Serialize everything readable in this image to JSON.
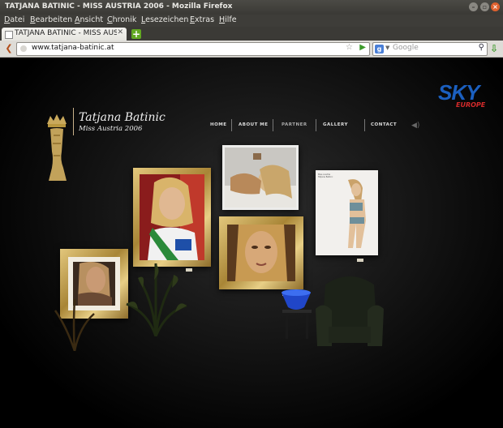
{
  "window": {
    "title": "TATJANA BATINIC - MISS AUSTRIA 2006 - Mozilla Firefox"
  },
  "menu": [
    "Datei",
    "Bearbeiten",
    "Ansicht",
    "Chronik",
    "Lesezeichen",
    "Extras",
    "Hilfe"
  ],
  "tab": {
    "label": "TATJANA BATINIC - MISS AUST..."
  },
  "urlbar": {
    "value": "www.tatjana-batinic.at"
  },
  "search": {
    "engine": "Google",
    "placeholder": "Google"
  },
  "site": {
    "name": "Tatjana Batinic",
    "subtitle": "Miss Austria 2006",
    "sponsor": {
      "word": "SKY",
      "sub": "EUROPE",
      "color": "#1b5fbf",
      "accent": "#d32a2a"
    },
    "nav": [
      "HOME",
      "ABOUT ME",
      "PARTNER",
      "GALLERY",
      "CONTACT"
    ],
    "active_nav": "PARTNER",
    "poster": {
      "heading": "Miss Austria",
      "line": "Tatjana Batinic"
    }
  },
  "colors": {
    "gold": "#b8963e",
    "background": "#000000",
    "firefox_accent": "#e0612e"
  }
}
